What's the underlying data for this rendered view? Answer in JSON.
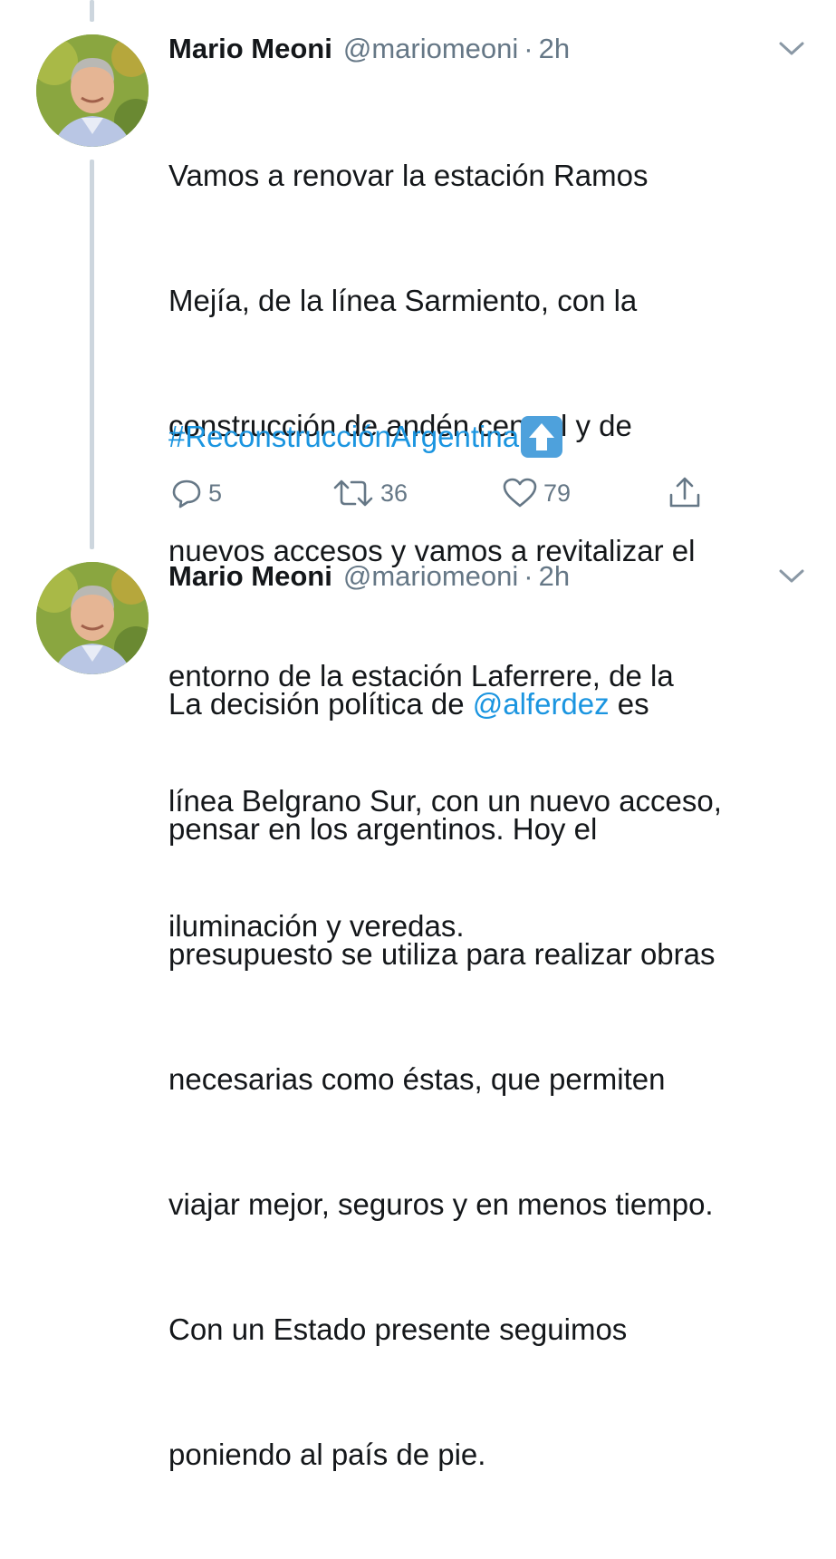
{
  "tweets": [
    {
      "author_name": "Mario Meoni",
      "author_handle": "@mariomeoni",
      "separator": "·",
      "time": "2h",
      "text_lines": [
        "Vamos a renovar la estación Ramos",
        "Mejía, de la línea Sarmiento, con la",
        "construcción de andén central y de",
        "nuevos accesos y vamos a revitalizar el",
        "entorno de la estación Laferrere, de la",
        "línea Belgrano Sur, con un nuevo acceso,",
        "iluminación y veredas."
      ],
      "hashtag": "#ReconstrucciónArgentina",
      "emoji_icon": "up-arrow-emoji-icon",
      "actions": {
        "reply_count": "5",
        "retweet_count": "36",
        "like_count": "79"
      }
    },
    {
      "author_name": "Mario Meoni",
      "author_handle": "@mariomeoni",
      "separator": "·",
      "time": "2h",
      "text_line1_prefix": "La decisión política de ",
      "mention": "@alferdez",
      "text_line1_suffix": " es",
      "text_lines": [
        "pensar en los argentinos. Hoy el",
        "presupuesto se utiliza para realizar obras",
        "necesarias como éstas, que permiten",
        "viajar mejor, seguros y en menos tiempo.",
        "Con un Estado presente seguimos",
        "poniendo al país de pie."
      ]
    }
  ],
  "colors": {
    "link": "#1b95e0",
    "secondary_text": "#657786",
    "thread_line": "#cdd6de"
  },
  "icons": [
    "reply-icon",
    "retweet-icon",
    "like-icon",
    "share-icon",
    "chevron-down-icon"
  ]
}
